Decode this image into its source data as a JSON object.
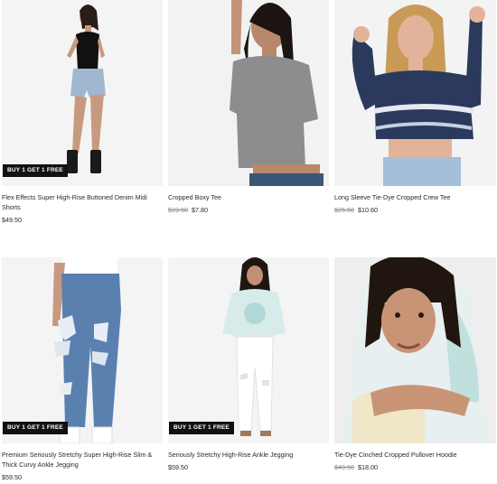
{
  "products": [
    {
      "name": "Flex Effects Super High-Rise Buttoned Denim Midi Shorts",
      "badge": "BUY 1 GET 1 FREE",
      "price_old": "",
      "price": "$49.50"
    },
    {
      "name": "Cropped Boxy Tee",
      "badge": "",
      "price_old": "$19.50",
      "price": "$7.80"
    },
    {
      "name": "Long Sleeve Tie-Dye Cropped Crew Tee",
      "badge": "",
      "price_old": "$26.50",
      "price": "$10.60"
    },
    {
      "name": "Premium Seriously Stretchy Super High-Rise Slim & Thick Curvy Ankle Jegging",
      "badge": "BUY 1 GET 1 FREE",
      "price_old": "",
      "price": "$59.50"
    },
    {
      "name": "Seriously Stretchy High-Rise Ankle Jegging",
      "badge": "BUY 1 GET 1 FREE",
      "price_old": "",
      "price": "$59.50"
    },
    {
      "name": "Tie-Dye Cinched Cropped Pullover Hoodie",
      "badge": "",
      "price_old": "$49.50",
      "price": "$18.00"
    }
  ]
}
